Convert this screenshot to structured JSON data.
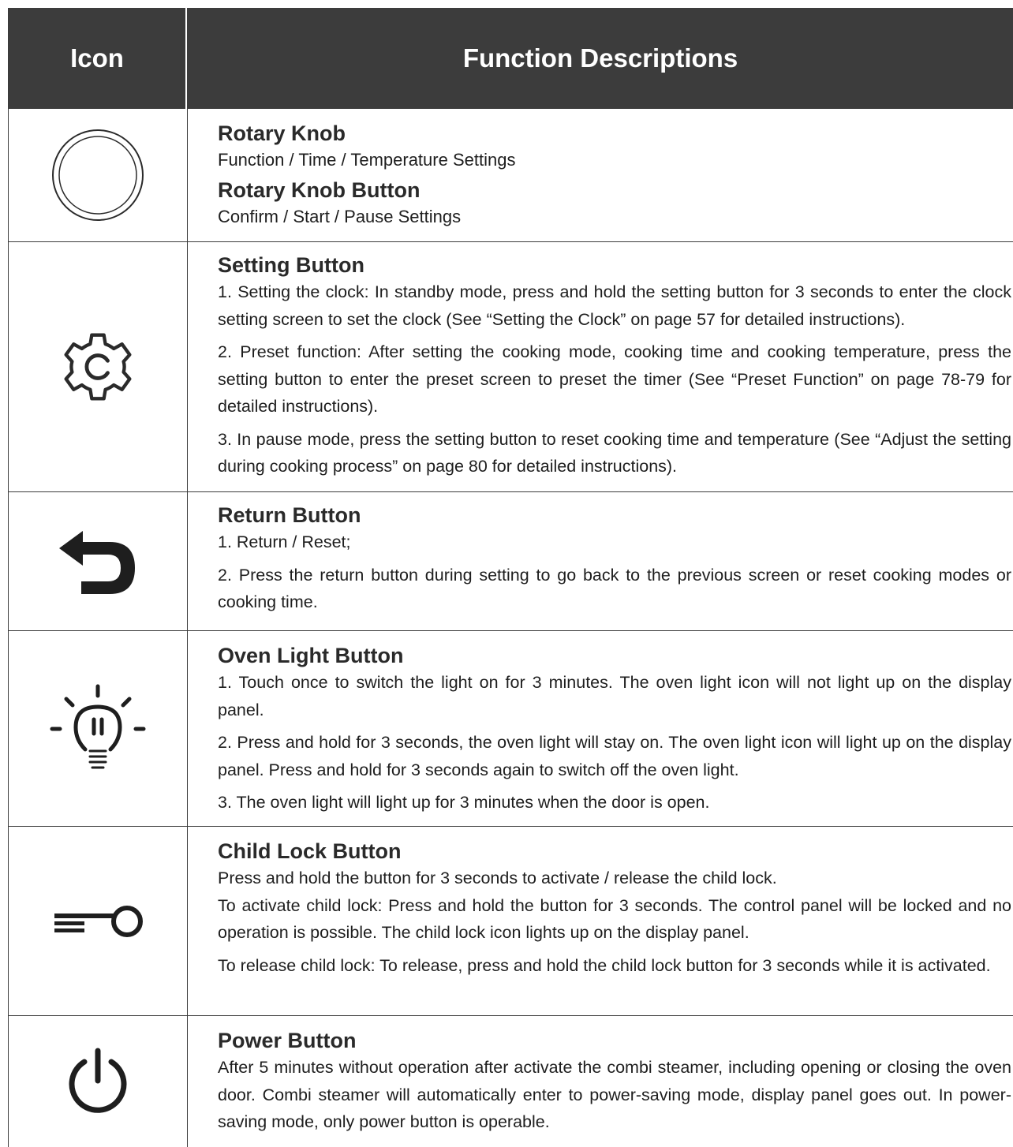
{
  "header": {
    "icon_col": "Icon",
    "desc_col": "Function Descriptions"
  },
  "rows": [
    {
      "icon": "rotary-knob-icon",
      "title": "Rotary Knob",
      "subtitle": "Function / Time / Temperature Settings",
      "title2": "Rotary Knob Button",
      "subtitle2": "Confirm / Start / Pause Settings"
    },
    {
      "icon": "gear-icon",
      "title": "Setting Button",
      "paras": [
        "1. Setting the clock: In standby mode, press and hold the setting button for 3 seconds to enter the clock setting screen to set the clock (See “Setting the Clock” on page 57 for detailed instructions).",
        "2. Preset function: After setting the cooking mode, cooking time and cooking temperature, press the setting button to enter the preset screen to preset the timer (See “Preset Function” on page 78-79 for detailed instructions).",
        "3. In pause mode, press the setting button to reset cooking time and temperature (See “Adjust the setting during cooking process” on page 80 for detailed instructions)."
      ]
    },
    {
      "icon": "return-arrow-icon",
      "title": "Return Button",
      "paras": [
        "1. Return / Reset;",
        "2. Press the return button during setting to go back to the previous screen or reset cooking modes or cooking time."
      ]
    },
    {
      "icon": "light-bulb-icon",
      "title": "Oven Light Button",
      "paras": [
        "1. Touch once to switch the light on for 3 minutes. The oven light icon will not light up on the display panel.",
        "2. Press and hold for 3 seconds, the oven light will stay on. The oven light icon will light up on the display panel. Press and hold for 3 seconds again to switch off the oven light.",
        "3. The oven light will light up for 3 minutes when the door is open."
      ]
    },
    {
      "icon": "key-icon",
      "title": "Child Lock Button",
      "paras": [
        "Press and hold the button for 3 seconds to activate / release the child lock.",
        "To activate child lock: Press and hold the button for 3 seconds. The control panel will be locked and no operation is possible. The child lock icon lights up on the display panel.",
        "To release child lock: To release, press and hold the child lock button for 3 seconds while it is activated."
      ]
    },
    {
      "icon": "power-icon",
      "title": "Power Button",
      "paras": [
        "After 5 minutes without operation after activate the combi steamer, including opening or closing the oven door. Combi steamer will automatically enter to power-saving mode, display panel goes out. In power-saving mode, only power button is operable."
      ]
    }
  ]
}
